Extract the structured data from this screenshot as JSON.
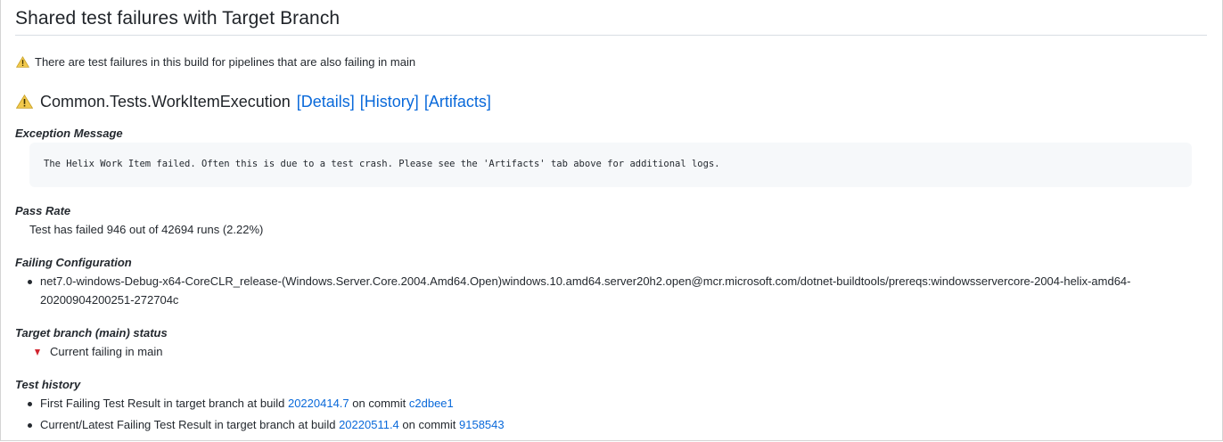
{
  "header": {
    "title": "Shared test failures with Target Branch"
  },
  "notice": {
    "text": "There are test failures in this build for pipelines that are also failing in main"
  },
  "test": {
    "name": "Common.Tests.WorkItemExecution",
    "links": {
      "details": "[Details]",
      "history": "[History]",
      "artifacts": "[Artifacts]"
    }
  },
  "exception": {
    "label": "Exception Message",
    "message": "The Helix Work Item failed. Often this is due to a test crash. Please see the 'Artifacts' tab above for additional logs."
  },
  "pass_rate": {
    "label": "Pass Rate",
    "text": "Test has failed 946 out of 42694 runs (2.22%)"
  },
  "failing_config": {
    "label": "Failing Configuration",
    "line1": "net7.0-windows-Debug-x64-CoreCLR_release-(Windows.Server.Core.2004.Amd64.Open)windows.10.amd64.server20h2.open@mcr.microsoft.com/dotnet-buildtools/prereqs:windowsservercore-2004-helix-amd64-",
    "line2": "20200904200251-272704c"
  },
  "target_status": {
    "label": "Target branch (main) status",
    "text": "Current failing in main",
    "color": "#d1242f"
  },
  "history": {
    "label": "Test history",
    "items": [
      {
        "prefix": "First Failing Test Result in target branch at build",
        "build": "20220414.7",
        "mid": "on commit",
        "commit": "c2dbee1"
      },
      {
        "prefix": "Current/Latest Failing Test Result in target branch at build",
        "build": "20220511.4",
        "mid": "on commit",
        "commit": "9158543"
      }
    ]
  },
  "colors": {
    "link": "#0969da",
    "warning": "#bf8700",
    "text": "#24292f"
  },
  "icons": {
    "warning": "warning-triangle-icon",
    "status": "red-down-triangle-icon",
    "bullet": "bullet-dot"
  }
}
